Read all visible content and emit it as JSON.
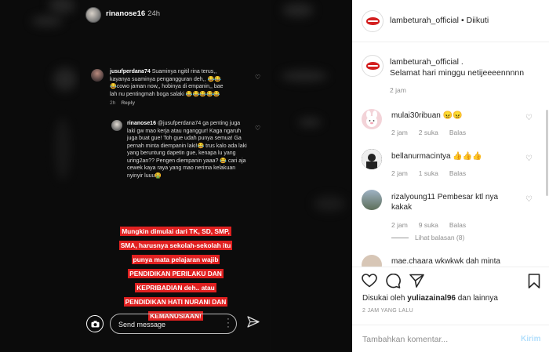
{
  "story": {
    "username": "rinanose16",
    "time": "24h",
    "comment1": {
      "user": "jusufperdana74",
      "text": "Suaminya ngitil rina terus,, kayanya suaminya pengangguran deh,, 😂😂 😂cowo jaman now,, hobinya di empanin,, bae lah nu pentingmah boga salaki 😂😂😂😂😂",
      "time": "2h",
      "reply": "Reply"
    },
    "reply1": {
      "user": "rinanose16",
      "text": "@jusufperdana74 ga penting juga laki gw mao kerja atau nganggur! Kaga ngaruh juga buat gue! Toh gue udah punya semua! Ga pernah minta diempanin laki!😂 trus kalo ada laki yang beruntung dapetin gue, kenapa lu yang uring2an?? Pengen diempanin yaaa? 😂 cari aja cewek kaya raya yang mao nerima kelakuan nyinyir luuu🤮"
    },
    "red_text": "Mungkin dimulai dari TK, SD, SMP, SMA, harusnya sekolah-sekolah itu punya mata pelajaran wajib PENDIDIKAN PERILAKU DAN KEPRIBADIAN deh.. atau PENDIDIKAN HATI NURANI DAN KEMANUSIAAN!",
    "send_placeholder": "Send message"
  },
  "post": {
    "account": "lambeturah_official",
    "follow_status": "Diikuti",
    "caption_user": "lambeturah_official .",
    "caption": "Selamat hari minggu netijeeeennnnn",
    "caption_time": "2 jam",
    "comments": [
      {
        "user": "mulai30ribuan",
        "text": "😠😠",
        "time": "2 jam",
        "likes": "2 suka",
        "reply": "Balas"
      },
      {
        "user": "bellanurmacintya",
        "text": "👍👍👍",
        "time": "2 jam",
        "likes": "1 suka",
        "reply": "Balas"
      },
      {
        "user": "rizalyoung11",
        "text": "Pembesar ktl nya kakak",
        "time": "2 jam",
        "likes": "9 suka",
        "reply": "Balas",
        "view_replies": "Lihat balasan (8)"
      },
      {
        "user": "mae.chaara",
        "text": "wkwkwk dah minta"
      }
    ],
    "liked_by_prefix": "Disukai oleh",
    "liked_by_user": "yuliazainal96",
    "liked_by_suffix": "dan lainnya",
    "post_time": "2 JAM YANG LALU",
    "comment_placeholder": "Tambahkan komentar...",
    "submit_label": "Kirim"
  },
  "colors": {
    "accent_red": "#e02020",
    "link_blue": "#b2dffc"
  }
}
